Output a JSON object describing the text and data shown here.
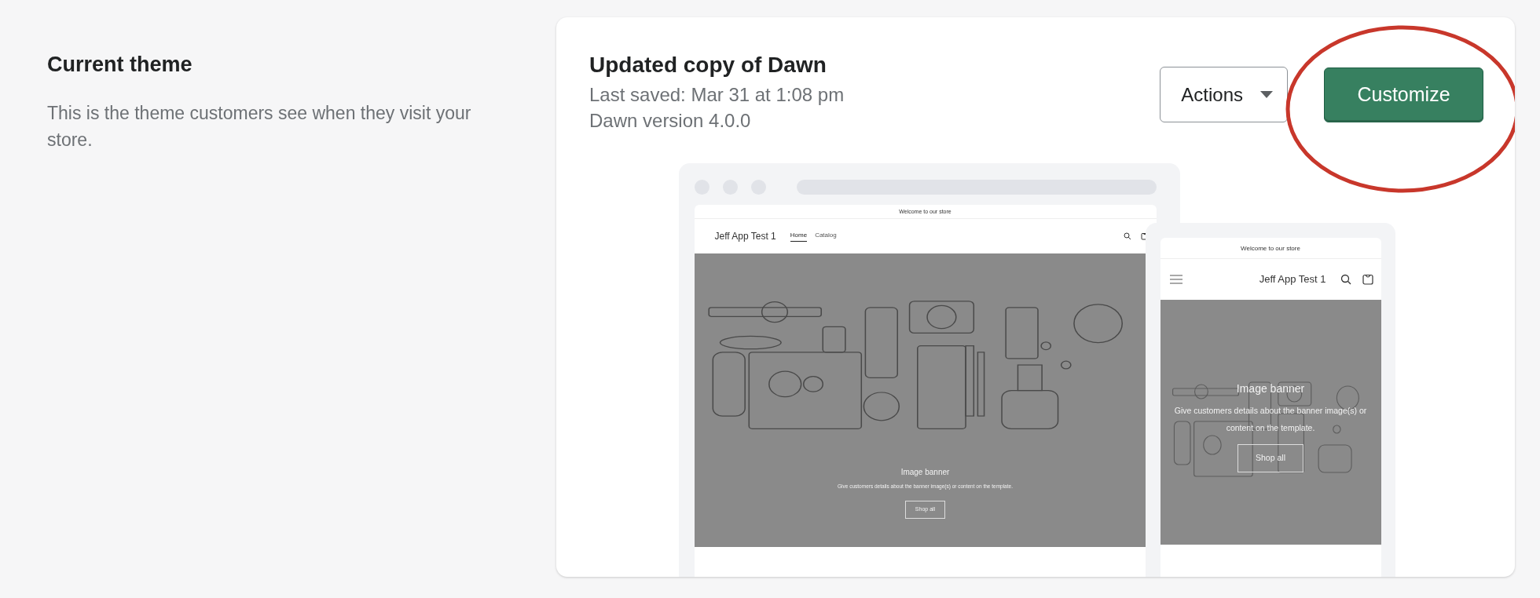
{
  "sidebar": {
    "title": "Current theme",
    "description": "This is the theme customers see when they visit your store."
  },
  "theme": {
    "name": "Updated copy of Dawn",
    "last_saved": "Last saved: Mar 31 at 1:08 pm",
    "version": "Dawn version 4.0.0"
  },
  "buttons": [
    {
      "label": "Actions",
      "kind": "menu"
    },
    {
      "label": "Customize",
      "kind": "primary",
      "circled": true
    }
  ],
  "desktop_preview": {
    "announcement": "Welcome to our store",
    "store_name": "Jeff App Test 1",
    "nav": [
      {
        "label": "Home",
        "selected": true
      },
      {
        "label": "Catalog",
        "selected": false
      }
    ],
    "banner": {
      "heading": "Image banner",
      "text": "Give customers details about the banner image(s) or content on the template.",
      "button": "Shop all"
    }
  },
  "mobile_preview": {
    "announcement": "Welcome to our store",
    "store_name": "Jeff App Test 1",
    "banner": {
      "heading": "Image banner",
      "text": "Give customers details about the banner image(s) or content on the template.",
      "button": "Shop all"
    }
  }
}
